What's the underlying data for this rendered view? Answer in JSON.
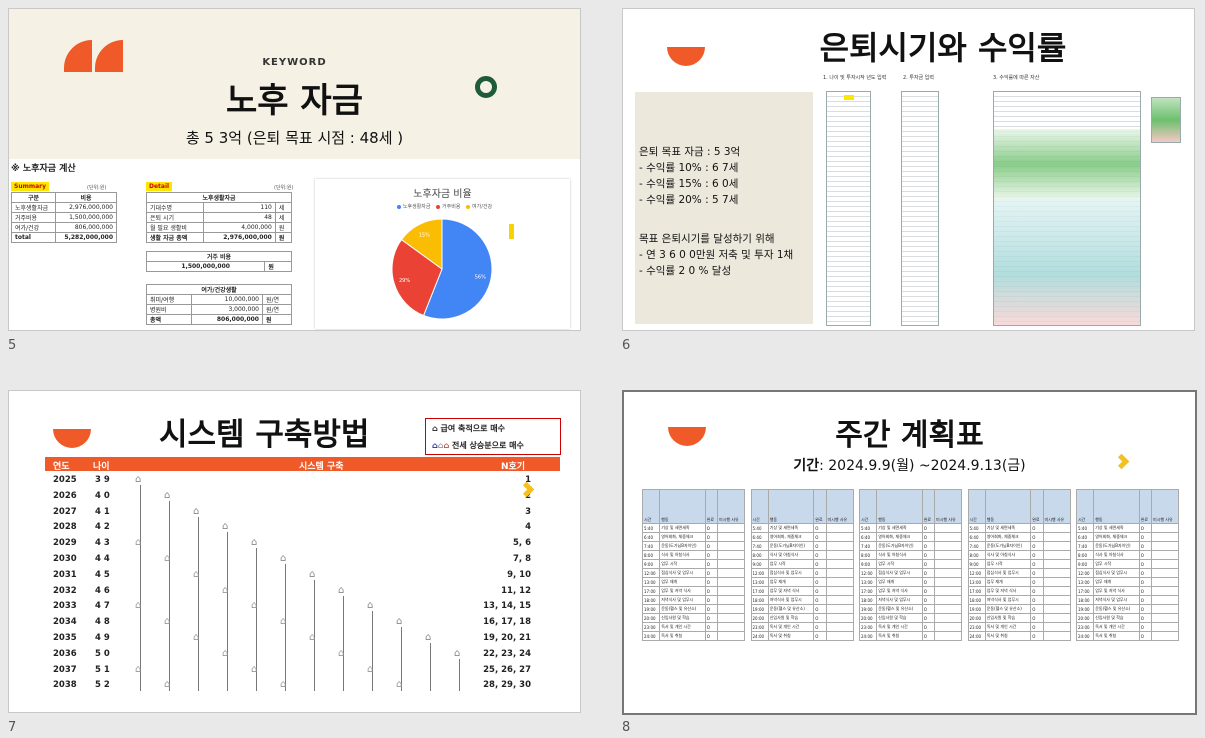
{
  "slides": [
    {
      "number": "5",
      "keyword": "KEYWORD",
      "title": "노후 자금",
      "subtitle": "총 5 3억  (은퇴 목표 시점 : 48세 )",
      "section": "※ 노후자금 계산",
      "summary": {
        "label": "Summary",
        "unit": "(단위:원)",
        "headers": [
          "구분",
          "비용"
        ],
        "rows": [
          [
            "노후생활자금",
            "2,976,000,000"
          ],
          [
            "거주비용",
            "1,500,000,000"
          ],
          [
            "여가/건강",
            "806,000,000"
          ],
          [
            "total",
            "5,282,000,000"
          ]
        ]
      },
      "detail": {
        "label": "Detail",
        "unit": "(단위:원)",
        "living_header": "노후생활자금",
        "living_rows": [
          [
            "기대수명",
            "110",
            "세"
          ],
          [
            "은퇴 시기",
            "48",
            "세"
          ],
          [
            "월 필요 생활비",
            "4,000,000",
            "원"
          ],
          [
            "생활 자금 총액",
            "2,976,000,000",
            "원"
          ]
        ],
        "housing_header": "거주 비용",
        "housing_value": "1,500,000,000",
        "housing_unit": "원",
        "leisure_header": "여가/건강생활",
        "leisure_rows": [
          [
            "취미/여행",
            "10,000,000",
            "원/연"
          ],
          [
            "병원비",
            "3,000,000",
            "원/연"
          ],
          [
            "총액",
            "806,000,000",
            "원"
          ]
        ]
      },
      "pie": {
        "title": "노후자금 비율",
        "legend": [
          "노후생활자금",
          "거주비용",
          "여가/건강"
        ],
        "colors": [
          "#4285f4",
          "#ea4335",
          "#fbbc04"
        ],
        "values": [
          56,
          29,
          15
        ],
        "labels": [
          "56%",
          "29%",
          "15%"
        ]
      }
    },
    {
      "number": "6",
      "title": "은퇴시기와 수익률",
      "panel": [
        "은퇴 목표 자금 :  5 3억",
        "-  수익률 10% :  6 7세",
        "-  수익률 15% :  6 0세",
        "-  수익률 20% :  5 7세",
        "목표 은퇴시기를 달성하기 위해",
        "-  연  3 6 0 0만원 저축 및 투자 1채",
        "-  수익률  2 0 % 달성"
      ],
      "table_headers": [
        "1. 나이 및 투자시작 년도 입력",
        "2. 투자금 입력",
        "3. 수익률에 따른 자산"
      ]
    },
    {
      "number": "7",
      "title": "시스템 구축방법",
      "legend": [
        "급여 축적으로 매수",
        "전세 상승분으로 매수"
      ],
      "headers": [
        "연도",
        "나이",
        "시스템 구축",
        "N호기"
      ],
      "rows": [
        [
          "2025",
          "3 9",
          "1"
        ],
        [
          "2026",
          "4 0",
          "2"
        ],
        [
          "2027",
          "4 1",
          "3"
        ],
        [
          "2028",
          "4 2",
          "4"
        ],
        [
          "2029",
          "4 3",
          "5, 6"
        ],
        [
          "2030",
          "4 4",
          "7, 8"
        ],
        [
          "2031",
          "4 5",
          "9, 10"
        ],
        [
          "2032",
          "4 6",
          "11, 12"
        ],
        [
          "2033",
          "4 7",
          "13, 14, 15"
        ],
        [
          "2034",
          "4 8",
          "16, 17, 18"
        ],
        [
          "2035",
          "4 9",
          "19, 20, 21"
        ],
        [
          "2036",
          "5 0",
          "22, 23, 24"
        ],
        [
          "2037",
          "5 1",
          "25, 26, 27"
        ],
        [
          "2038",
          "5 2",
          "28, 29, 30"
        ]
      ]
    },
    {
      "number": "8",
      "title": "주간 계획표",
      "period_label": "기간",
      "period": ": 2024.9.9(월) ~2024.9.13(금)",
      "columns": [
        "시간",
        "행동",
        "완료",
        "미시행 사유"
      ],
      "schedule": [
        [
          "5:40",
          "기상 및 세면세족"
        ],
        [
          "6:40",
          "영어회화, 체중체크"
        ],
        [
          "7:40",
          "운동(도가님B자이인)"
        ],
        [
          "8:00",
          "식사 및 아침식사"
        ],
        [
          "9:00",
          "업무 시작"
        ],
        [
          "12:00",
          "점심식사 및 업무시"
        ],
        [
          "13:00",
          "업무 재개"
        ],
        [
          "17:00",
          "업무 및 저녁 식사"
        ],
        [
          "18:00",
          "저녁식사 및 업무시"
        ],
        [
          "19:00",
          "운동(헬스 및 유산소)"
        ],
        [
          "20:00",
          "신입사원 및 학습"
        ],
        [
          "23:00",
          "독서 및 개인 시간"
        ],
        [
          "24:00",
          "독서 및 취침"
        ]
      ]
    }
  ]
}
